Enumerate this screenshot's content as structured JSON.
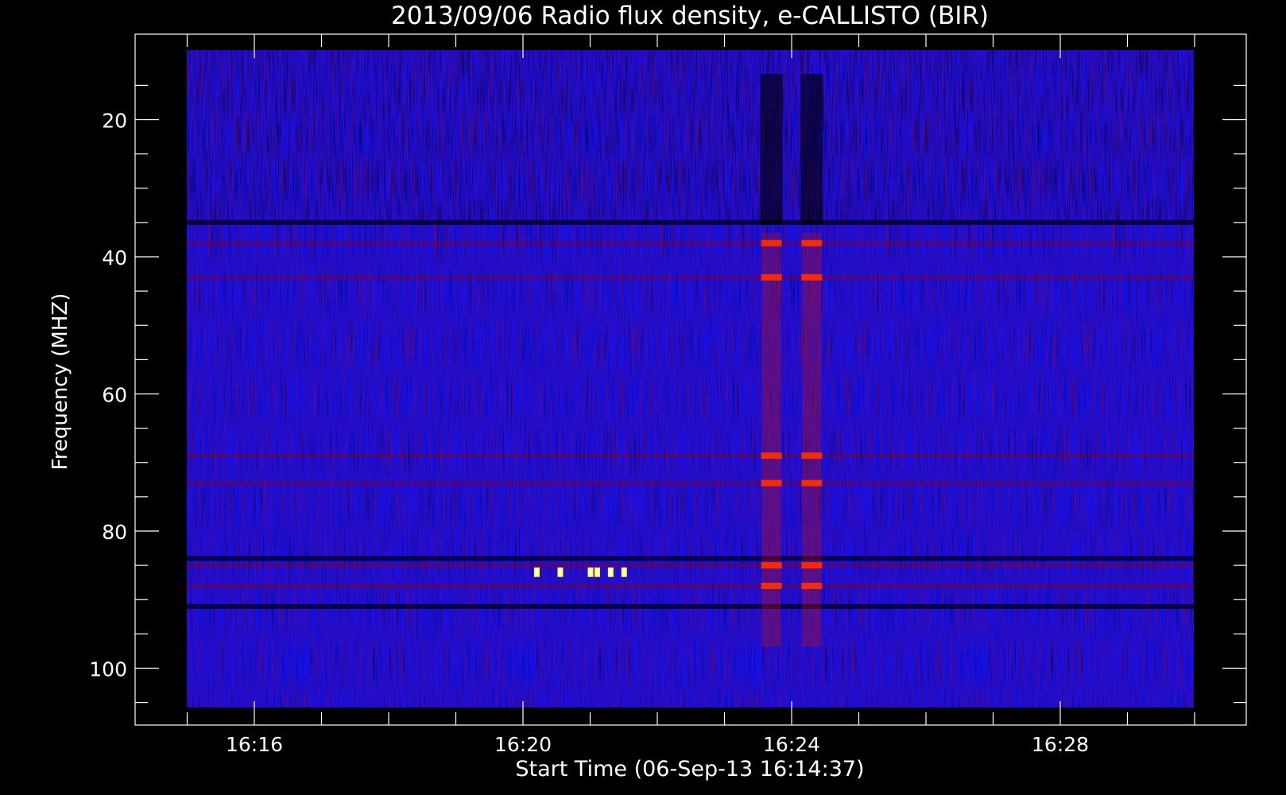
{
  "chart_data": {
    "type": "heatmap",
    "title": "2013/09/06  Radio flux density, e-CALLISTO (BIR)",
    "xlabel": "Start Time (06-Sep-13 16:14:37)",
    "ylabel": "Frequency (MHZ)",
    "x_range": [
      "16:14:37",
      "16:30:00"
    ],
    "x_ticks": [
      "16:16",
      "16:20",
      "16:24",
      "16:28"
    ],
    "x_tick_minutes": [
      16,
      20,
      24,
      28
    ],
    "y_range": [
      10,
      106
    ],
    "y_reversed": true,
    "y_ticks": [
      20,
      40,
      60,
      80,
      100
    ],
    "grid": false,
    "legend": "none",
    "colormap": [
      "#000000",
      "#0000ff",
      "#b00000",
      "#ff3000",
      "#ffff00",
      "#ffffff"
    ],
    "background_level": "#1010f0",
    "features": {
      "vertical_bursts_min": [
        23.7,
        24.3
      ],
      "bright_spike_band_mhz": 86,
      "bright_spike_times_min": [
        20.2,
        20.55,
        21.0,
        21.1,
        21.3,
        21.5
      ],
      "dark_band_mhz": [
        35,
        84,
        91
      ],
      "red_band_mhz": [
        38,
        43,
        69,
        73,
        85,
        88
      ]
    }
  }
}
